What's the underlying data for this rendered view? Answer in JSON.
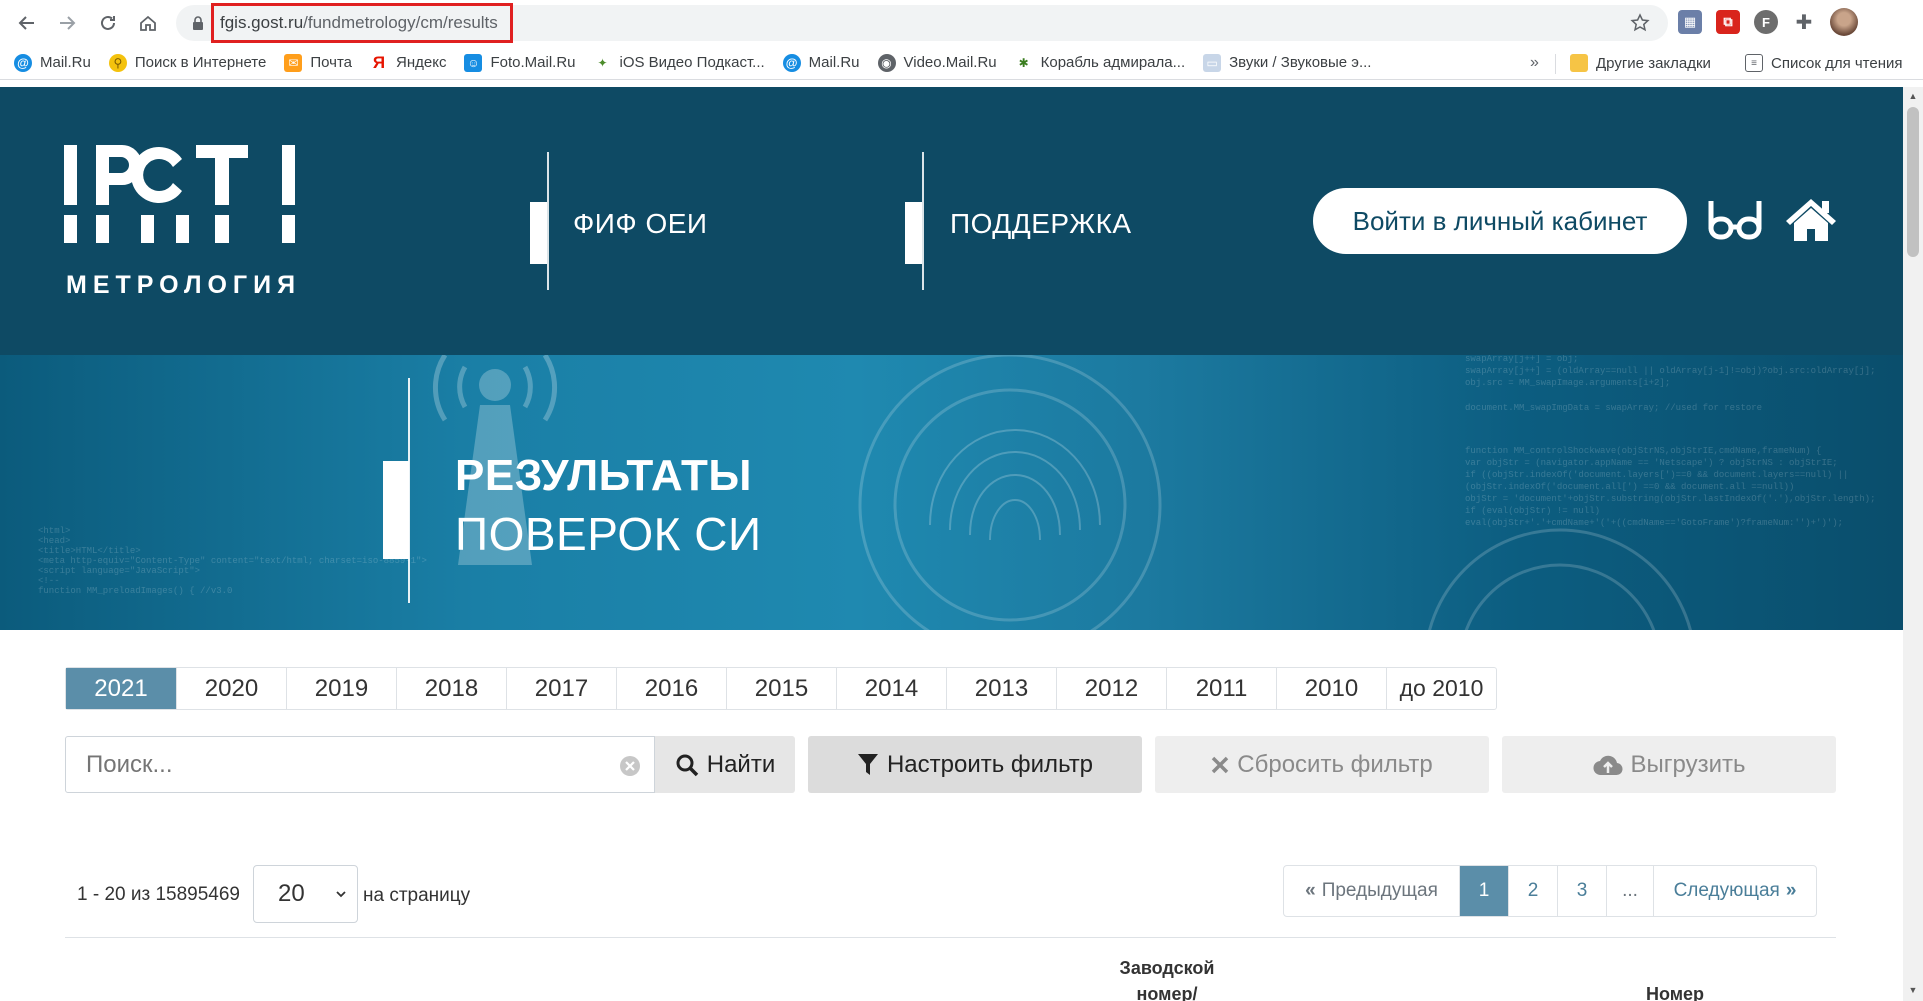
{
  "browser": {
    "url_host": "fgis.gost.ru",
    "url_path": "/fundmetrology/cm/results",
    "bookmarks": [
      {
        "label": "Mail.Ru",
        "icon": "mailru-icon"
      },
      {
        "label": "Поиск в Интернете",
        "icon": "search-key-icon"
      },
      {
        "label": "Почта",
        "icon": "mail-envelope-icon"
      },
      {
        "label": "Яндекс",
        "icon": "yandex-icon"
      },
      {
        "label": "Foto.Mail.Ru",
        "icon": "foto-icon"
      },
      {
        "label": "iOS Видео Подкаст...",
        "icon": "podcast-icon"
      },
      {
        "label": "Mail.Ru",
        "icon": "mailru-icon"
      },
      {
        "label": "Video.Mail.Ru",
        "icon": "video-icon"
      },
      {
        "label": "Корабль адмирала...",
        "icon": "bug-icon"
      },
      {
        "label": "Звуки / Звуковые э...",
        "icon": "page-icon"
      }
    ],
    "more_label": "»",
    "other_bookmarks": "Другие закладки",
    "reading_list": "Список для чтения"
  },
  "header": {
    "logo_word": "МЕТРОЛОГИЯ",
    "nav": [
      {
        "label": "ФИФ ОЕИ"
      },
      {
        "label": "ПОДДЕРЖКА"
      }
    ],
    "login_label": "Войти в личный кабинет"
  },
  "banner": {
    "title_line1": "РЕЗУЛЬТАТЫ",
    "title_line2": "ПОВЕРОК СИ"
  },
  "years": [
    "2021",
    "2020",
    "2019",
    "2018",
    "2017",
    "2016",
    "2015",
    "2014",
    "2013",
    "2012",
    "2011",
    "2010",
    "до 2010"
  ],
  "active_year": "2021",
  "search": {
    "placeholder": "Поиск...",
    "find_label": "Найти",
    "filter_label": "Настроить фильтр",
    "reset_label": "Сбросить фильтр",
    "export_label": "Выгрузить"
  },
  "results": {
    "count_text": "1 - 20 из 15895469",
    "per_page_value": "20",
    "per_page_label": "на страницу"
  },
  "pagination": {
    "prev_label": "Предыдущая",
    "pages": [
      "1",
      "2",
      "3"
    ],
    "active_page": "1",
    "dots": "...",
    "next_label": "Следующая"
  },
  "table_headers": {
    "serial_line1": "Заводской",
    "serial_line2": "номер/",
    "number": "Номер"
  }
}
